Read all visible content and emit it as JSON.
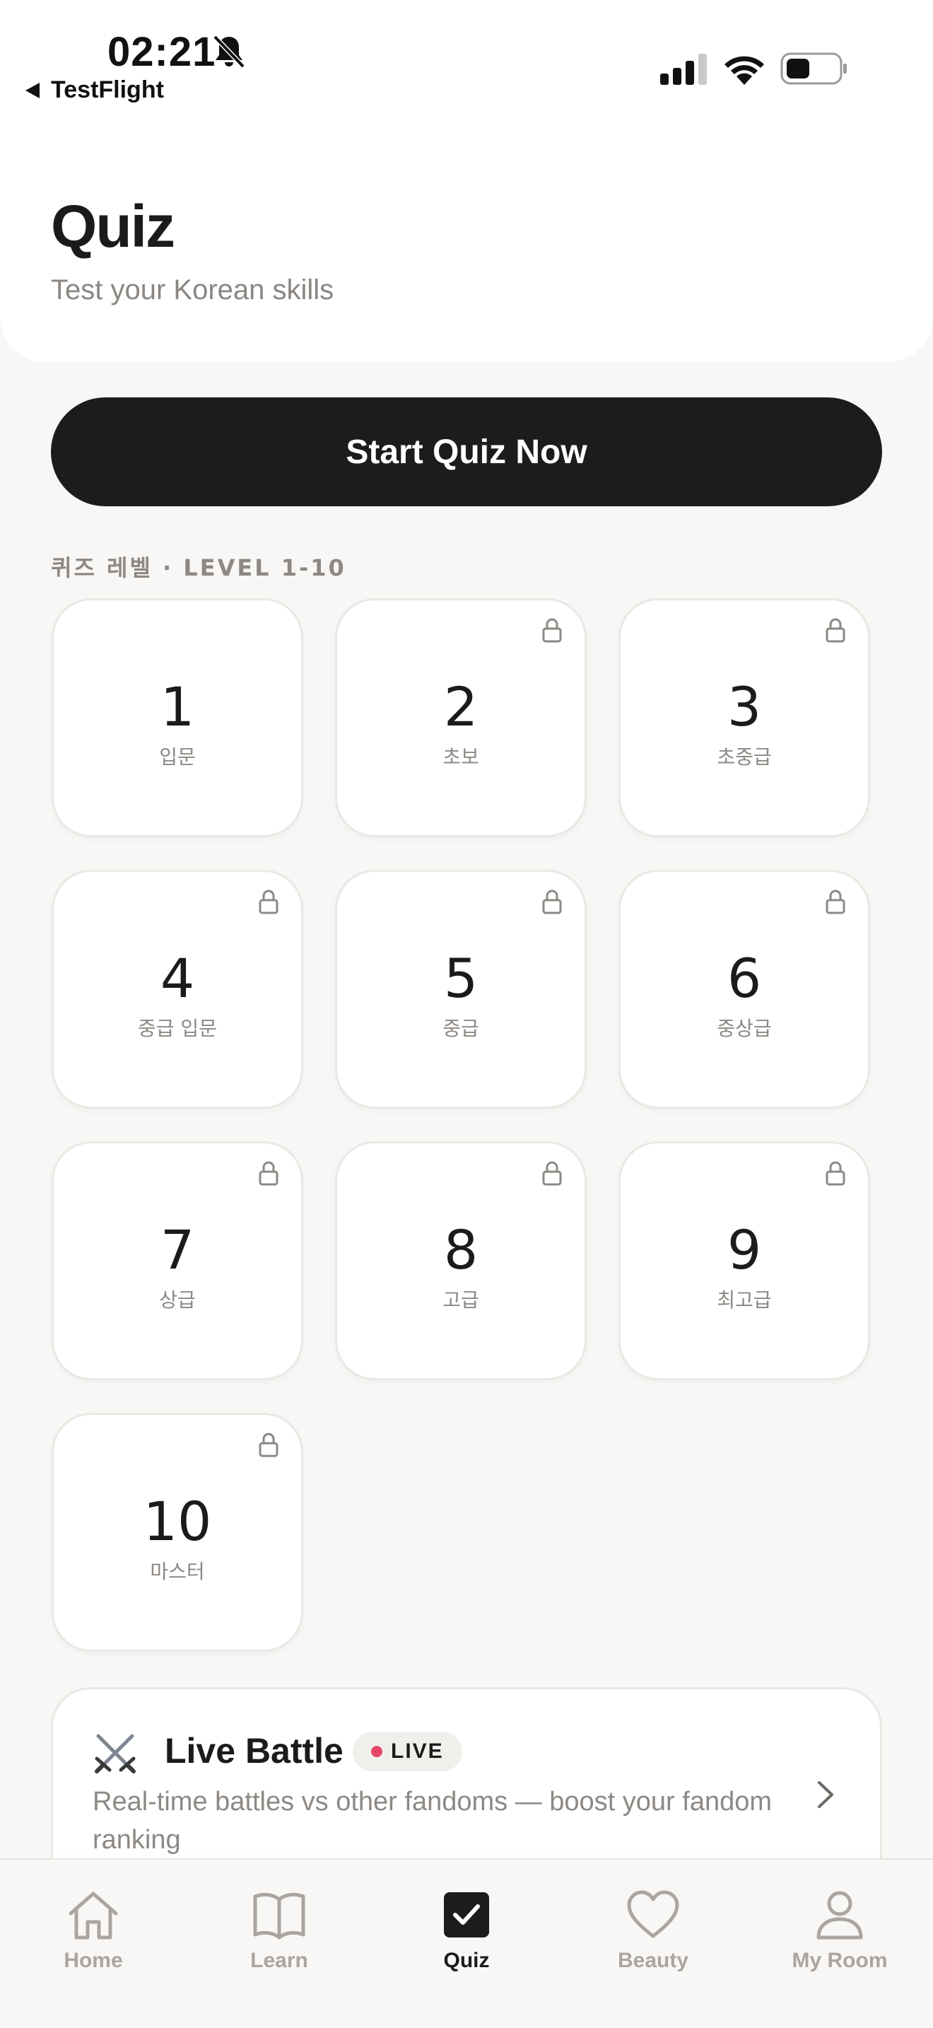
{
  "status_bar": {
    "time": "02:21",
    "back_app": "TestFlight"
  },
  "header": {
    "title": "Quiz",
    "subtitle": "Test your Korean skills"
  },
  "start_button": {
    "label": "Start Quiz Now"
  },
  "levels_section": {
    "label": "퀴즈 레벨 · LEVEL 1-10",
    "levels": [
      {
        "number": "1",
        "name": "입문",
        "locked": false
      },
      {
        "number": "2",
        "name": "초보",
        "locked": true
      },
      {
        "number": "3",
        "name": "초중급",
        "locked": true
      },
      {
        "number": "4",
        "name": "중급 입문",
        "locked": true
      },
      {
        "number": "5",
        "name": "중급",
        "locked": true
      },
      {
        "number": "6",
        "name": "중상급",
        "locked": true
      },
      {
        "number": "7",
        "name": "상급",
        "locked": true
      },
      {
        "number": "8",
        "name": "고급",
        "locked": true
      },
      {
        "number": "9",
        "name": "최고급",
        "locked": true
      },
      {
        "number": "10",
        "name": "마스터",
        "locked": true
      }
    ]
  },
  "live_battle": {
    "title": "Live Battle",
    "badge": "LIVE",
    "description": "Real-time battles vs other fandoms — boost your fandom ranking"
  },
  "tab_bar": {
    "tabs": [
      {
        "label": "Home",
        "icon": "home-icon",
        "active": false
      },
      {
        "label": "Learn",
        "icon": "book-icon",
        "active": false
      },
      {
        "label": "Quiz",
        "icon": "checkbox-icon",
        "active": true
      },
      {
        "label": "Beauty",
        "icon": "heart-icon",
        "active": false
      },
      {
        "label": "My Room",
        "icon": "person-icon",
        "active": false
      }
    ]
  },
  "colors": {
    "background": "#f8f7f5",
    "primary": "#1e1c1b",
    "muted_text": "#8d8883",
    "live_dot": "#e5476a"
  }
}
